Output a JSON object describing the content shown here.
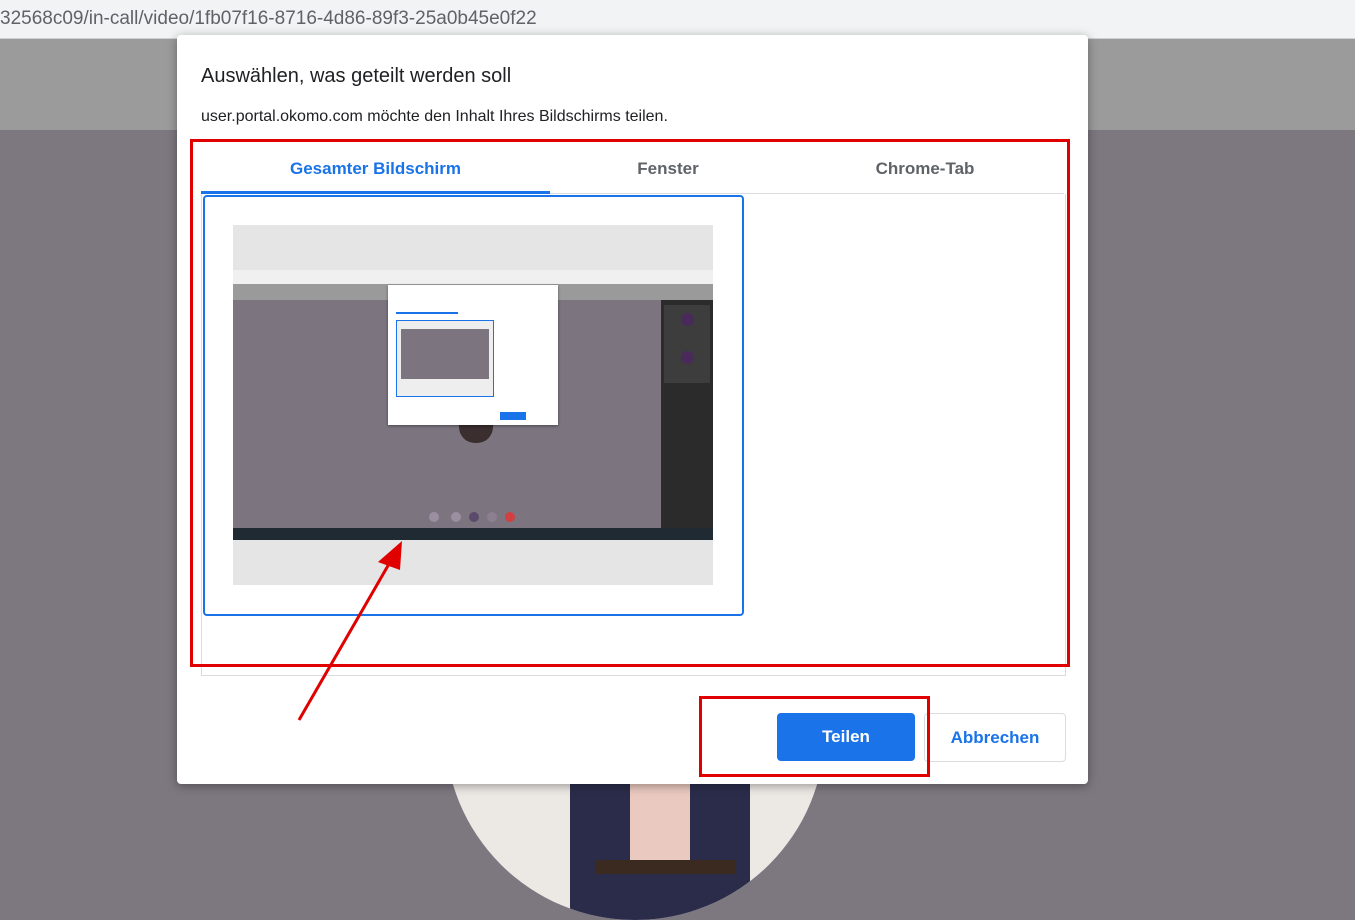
{
  "browser": {
    "url": "32568c09/in-call/video/1fb07f16-8716-4d86-89f3-25a0b45e0f22"
  },
  "dialog": {
    "title": "Auswählen, was geteilt werden soll",
    "subtitle": "user.portal.okomo.com möchte den Inhalt Ihres Bildschirms teilen.",
    "tabs": [
      {
        "label": "Gesamter Bildschirm",
        "active": true
      },
      {
        "label": "Fenster",
        "active": false
      },
      {
        "label": "Chrome-Tab",
        "active": false
      }
    ],
    "share_label": "Teilen",
    "cancel_label": "Abbrechen"
  },
  "colors": {
    "accent": "#1a73e8",
    "annotation": "#e00000",
    "background": "#7d7780"
  },
  "icons": {
    "annotation_arrow": "red-arrow"
  }
}
